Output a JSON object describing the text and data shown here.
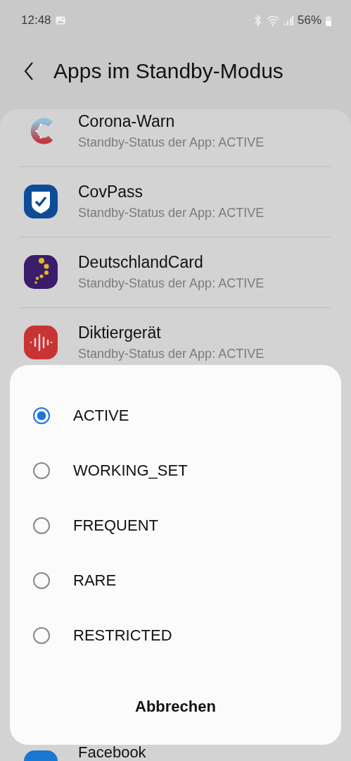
{
  "status_bar": {
    "time": "12:48",
    "battery": "56%"
  },
  "header": {
    "title": "Apps im Standby-Modus"
  },
  "apps": [
    {
      "name": "Corona-Warn",
      "status": "Standby-Status der App: ACTIVE",
      "kind": "corona"
    },
    {
      "name": "CovPass",
      "status": "Standby-Status der App: ACTIVE",
      "kind": "shield"
    },
    {
      "name": "DeutschlandCard",
      "status": "Standby-Status der App: ACTIVE",
      "kind": "dots"
    },
    {
      "name": "Diktiergerät",
      "status": "Standby-Status der App: ACTIVE",
      "kind": "recorder"
    },
    {
      "name": "Facebook",
      "kind": "facebook"
    }
  ],
  "dialog": {
    "options": [
      {
        "label": "ACTIVE",
        "selected": true
      },
      {
        "label": "WORKING_SET",
        "selected": false
      },
      {
        "label": "FREQUENT",
        "selected": false
      },
      {
        "label": "RARE",
        "selected": false
      },
      {
        "label": "RESTRICTED",
        "selected": false
      }
    ],
    "cancel": "Abbrechen"
  }
}
